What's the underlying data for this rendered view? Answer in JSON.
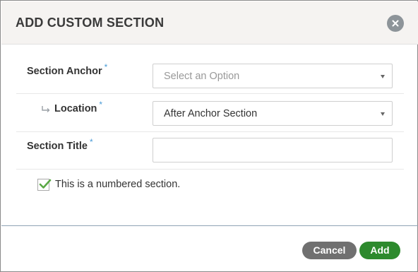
{
  "dialog": {
    "title": "ADD CUSTOM SECTION",
    "close_icon": "close-icon"
  },
  "form": {
    "section_anchor": {
      "label": "Section Anchor",
      "required_marker": "*",
      "value": "",
      "placeholder": "Select an Option"
    },
    "location": {
      "label": "Location",
      "required_marker": "*",
      "value": "After Anchor Section",
      "indent_icon": "indent-arrow-icon"
    },
    "section_title": {
      "label": "Section Title",
      "required_marker": "*",
      "value": ""
    },
    "numbered": {
      "label": "This is a numbered section.",
      "checked": true
    }
  },
  "footer": {
    "cancel_label": "Cancel",
    "add_label": "Add"
  },
  "colors": {
    "accent_required": "#4a9bd6",
    "add_button": "#2d8a2d",
    "cancel_button": "#707070",
    "checkmark": "#5aa845"
  }
}
